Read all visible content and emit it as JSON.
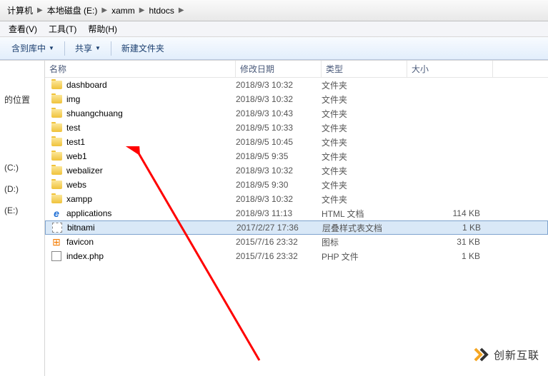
{
  "breadcrumb": [
    "计算机",
    "本地磁盘 (E:)",
    "xamm",
    "htdocs"
  ],
  "menus": [
    "查看(V)",
    "工具(T)",
    "帮助(H)"
  ],
  "toolbar": {
    "include": "含到库中",
    "share": "共享",
    "newfolder": "新建文件夹"
  },
  "sidebar": [
    "",
    "",
    "的位置",
    "",
    "",
    "",
    "",
    "(C:)",
    "(D:)",
    "(E:)"
  ],
  "columns": {
    "name": "名称",
    "date": "修改日期",
    "type": "类型",
    "size": "大小"
  },
  "files": [
    {
      "icon": "folder",
      "name": "dashboard",
      "date": "2018/9/3 10:32",
      "type": "文件夹",
      "size": ""
    },
    {
      "icon": "folder",
      "name": "img",
      "date": "2018/9/3 10:32",
      "type": "文件夹",
      "size": ""
    },
    {
      "icon": "folder",
      "name": "shuangchuang",
      "date": "2018/9/3 10:43",
      "type": "文件夹",
      "size": ""
    },
    {
      "icon": "folder",
      "name": "test",
      "date": "2018/9/5 10:33",
      "type": "文件夹",
      "size": ""
    },
    {
      "icon": "folder",
      "name": "test1",
      "date": "2018/9/5 10:45",
      "type": "文件夹",
      "size": ""
    },
    {
      "icon": "folder",
      "name": "web1",
      "date": "2018/9/5 9:35",
      "type": "文件夹",
      "size": ""
    },
    {
      "icon": "folder",
      "name": "webalizer",
      "date": "2018/9/3 10:32",
      "type": "文件夹",
      "size": ""
    },
    {
      "icon": "folder",
      "name": "webs",
      "date": "2018/9/5 9:30",
      "type": "文件夹",
      "size": ""
    },
    {
      "icon": "folder",
      "name": "xampp",
      "date": "2018/9/3 10:32",
      "type": "文件夹",
      "size": ""
    },
    {
      "icon": "ie",
      "name": "applications",
      "date": "2018/9/3 11:13",
      "type": "HTML 文档",
      "size": "114 KB"
    },
    {
      "icon": "css",
      "name": "bitnami",
      "date": "2017/2/27 17:36",
      "type": "层叠样式表文档",
      "size": "1 KB",
      "selected": true
    },
    {
      "icon": "fav",
      "name": "favicon",
      "date": "2015/7/16 23:32",
      "type": "图标",
      "size": "31 KB"
    },
    {
      "icon": "php",
      "name": "index.php",
      "date": "2015/7/16 23:32",
      "type": "PHP 文件",
      "size": "1 KB"
    }
  ],
  "watermark": "创新互联"
}
